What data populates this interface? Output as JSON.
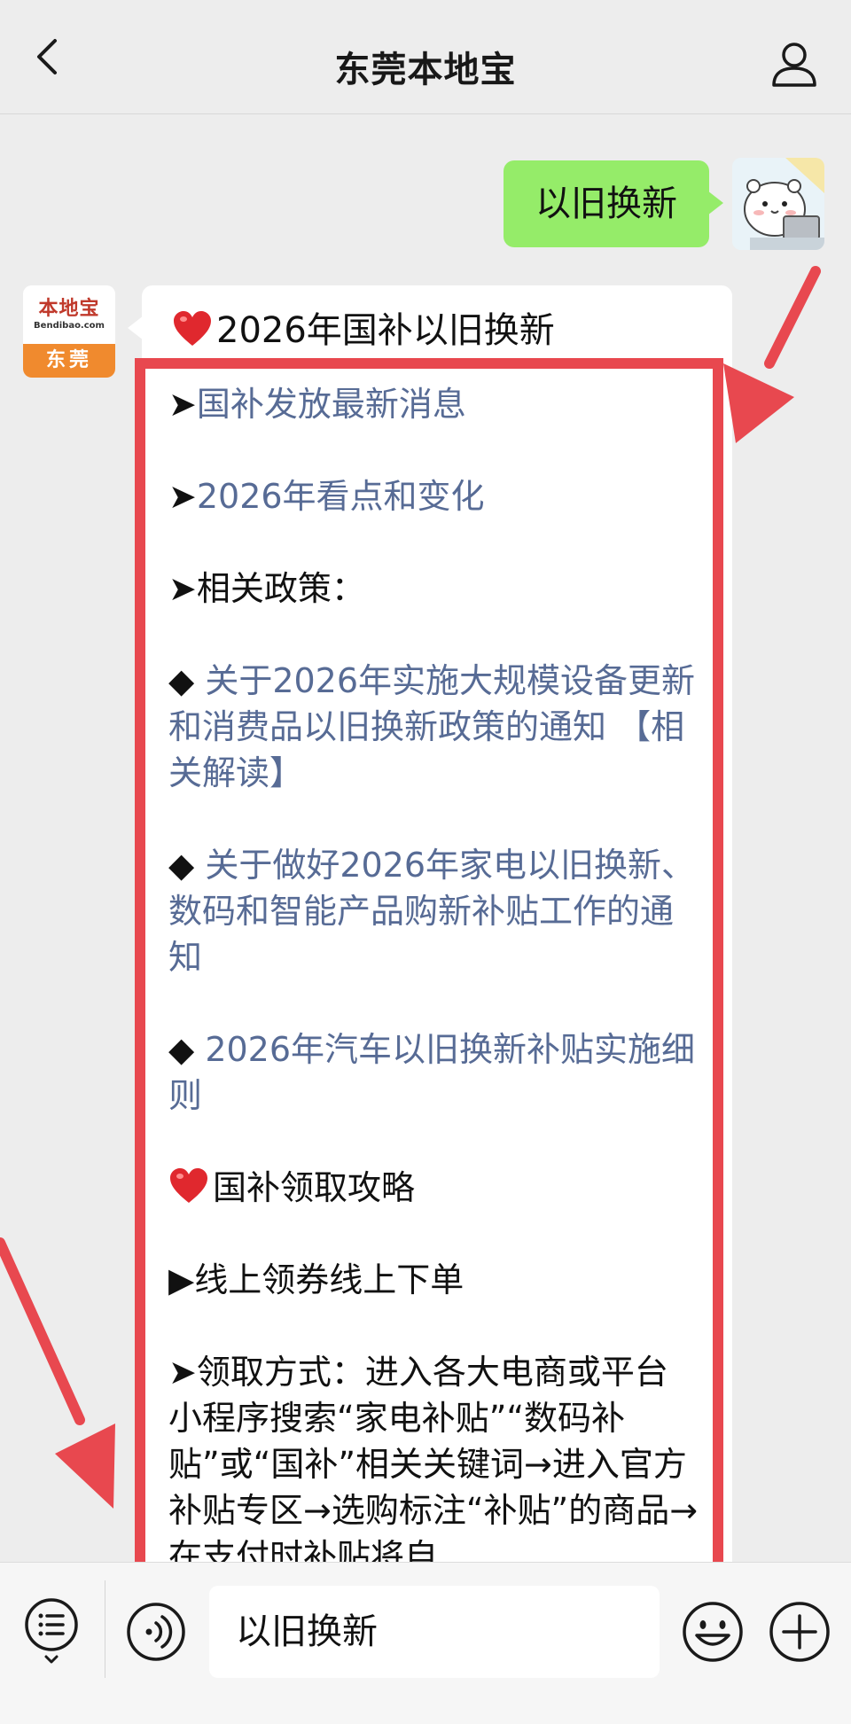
{
  "header": {
    "title": "东莞本地宝",
    "back_icon": "chevron-left-icon",
    "profile_icon": "person-icon"
  },
  "sent_message": {
    "text": "以旧换新"
  },
  "bot": {
    "logo_main": "本地宝",
    "logo_domain": "Bendibao.com",
    "logo_city": "东莞"
  },
  "message": {
    "heading": "2026年国补以旧换新",
    "lines": {
      "link1": "国补发放最新消息",
      "link2": "2026年看点和变化",
      "policy_label": "相关政策：",
      "policy1": "关于2026年实施大规模设备更新和消费品以旧换新政策的通知",
      "policy1_extra": "【相关解读】",
      "policy2": "关于做好2026年家电以旧换新、数码和智能产品购新补贴工作的通知",
      "policy3": "2026年汽车以旧换新补贴实施细则",
      "section2": "国补领取攻略",
      "online": "线上领券线上下单",
      "method": "➤领取方式：进入各大电商或平台小程序搜索“家电补贴”“数码补贴”或“国补”相关关键词→进入官方补贴专区→选购标注“补贴”的商品→在支付时补贴将自"
    }
  },
  "input": {
    "value": "以旧换新"
  },
  "colors": {
    "link": "#576b95",
    "sent_bubble": "#95ec69",
    "highlight": "#e8484f",
    "logo_orange": "#f08a2e"
  }
}
